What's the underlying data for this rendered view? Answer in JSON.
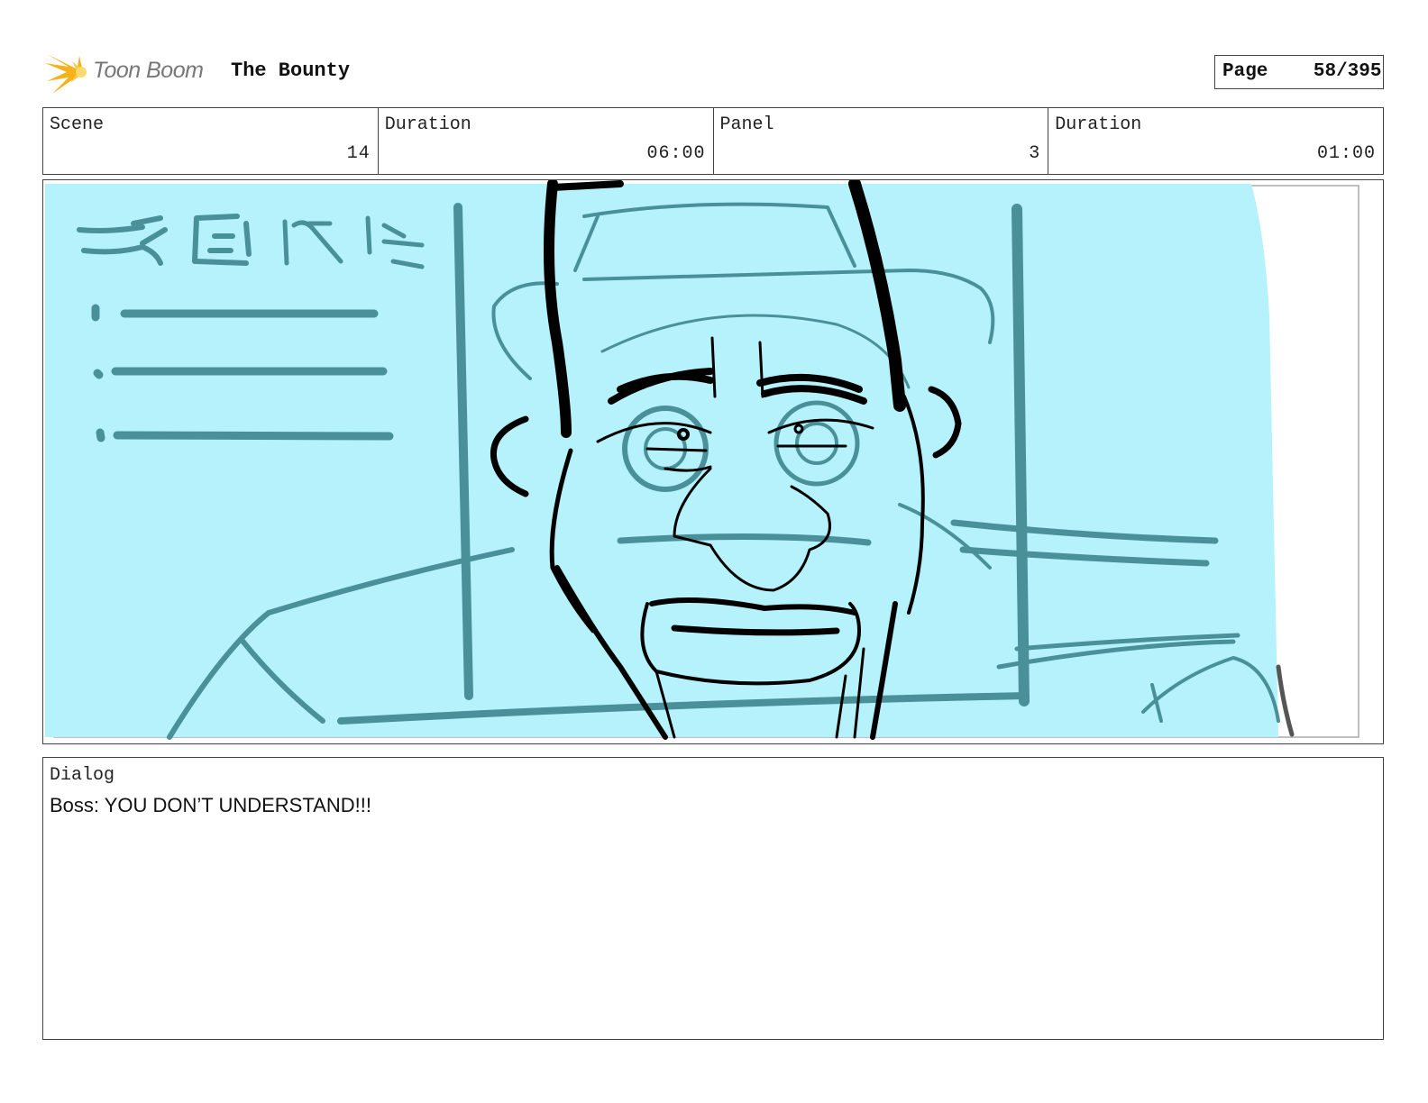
{
  "header": {
    "logo_text": "Toon Boom",
    "project_title": "The Bounty",
    "page_label": "Page",
    "page_value": "58/395"
  },
  "info": {
    "scene_label": "Scene",
    "scene_value": "14",
    "scene_duration_label": "Duration",
    "scene_duration_value": "06:00",
    "panel_label": "Panel",
    "panel_value": "3",
    "panel_duration_label": "Duration",
    "panel_duration_value": "01:00"
  },
  "dialog": {
    "label": "Dialog",
    "text": "Boss: YOU DON’T UNDERSTAND!!!"
  },
  "colors": {
    "sketch_fill": "#b6f2fb",
    "sketch_line": "#4a9099",
    "ink": "#000000"
  }
}
